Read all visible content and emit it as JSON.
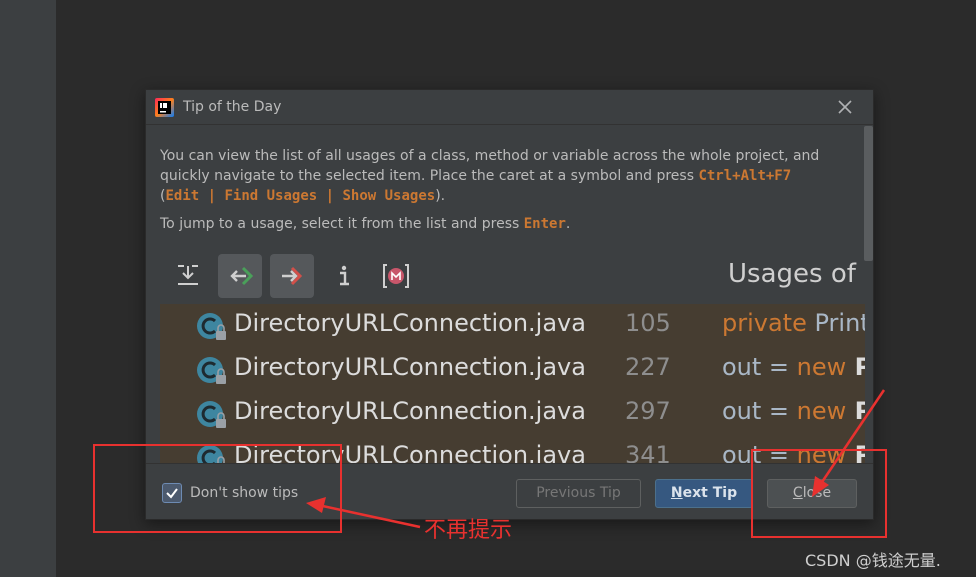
{
  "dialog": {
    "title": "Tip of the Day",
    "tip": {
      "line1": "You can view the list of all usages of a class, method or variable across the whole project, and",
      "line2_prefix": "quickly navigate to the selected item. Place the caret at a symbol and press ",
      "shortcut": "Ctrl+Alt+F7",
      "line3_open": "(",
      "menu_path": "Edit | Find Usages | Show Usages",
      "line3_close": ").",
      "line4_prefix": "To jump to a usage, select it from the list and press ",
      "enter_key": "Enter",
      "line4_suffix": "."
    },
    "preview": {
      "usages_title": "Usages of P",
      "rows": [
        {
          "file": "DirectoryURLConnection.java",
          "line": "105",
          "code_kw": "private",
          "code_rest": " Print"
        },
        {
          "file": "DirectoryURLConnection.java",
          "line": "227",
          "code_plain": "out = ",
          "code_kw": "new",
          "code_bold": " P"
        },
        {
          "file": "DirectoryURLConnection.java",
          "line": "297",
          "code_plain": "out = ",
          "code_kw": "new",
          "code_bold": " P"
        },
        {
          "file": "DirectoryURLConnection.java",
          "line": "341",
          "code_plain": "out = ",
          "code_kw": "new",
          "code_bold": " P"
        }
      ]
    },
    "footer": {
      "dont_show_label": "Don't show tips",
      "dont_show_checked": true,
      "prev_label": "Previous Tip",
      "next_mnemonic": "N",
      "next_rest": "ext Tip",
      "close_mnemonic": "C",
      "close_rest": "lose"
    }
  },
  "annotation": {
    "text": "不再提示"
  },
  "watermark": "CSDN @钱途无量."
}
